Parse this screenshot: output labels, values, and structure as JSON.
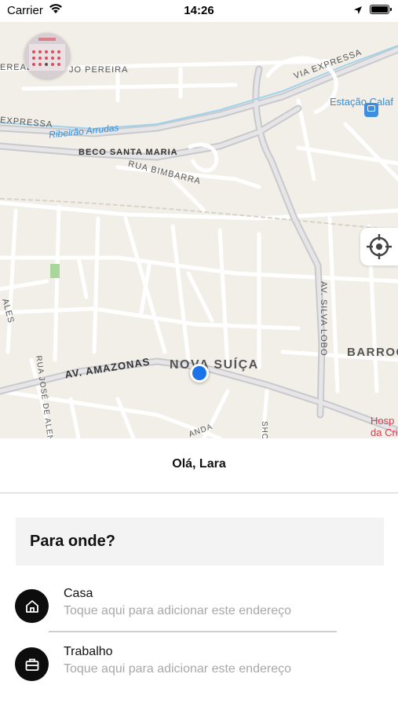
{
  "status_bar": {
    "carrier": "Carrier",
    "time": "14:26"
  },
  "map": {
    "labels": {
      "via_expressa": "VIA EXPRESSA",
      "expressa": "EXPRESSA",
      "ribeirao": "Ribeirão Arrudas",
      "beco": "BECO SANTA MARIA",
      "bimbarra": "RUA BIMBARRA",
      "amazonas": "AV. AMAZONAS",
      "nova_suica": "NOVA SUÍÇA",
      "silva_lobo": "AV. SILVA LOBO",
      "barroca": "BARROC",
      "estacao": "Estação Calaf",
      "hospital_1": "Hosp",
      "hospital_2": "da Cri",
      "jose_alencar": "RUA JOSÉ DE ALENCA",
      "ereal": "EREAL",
      "jo_pereira": "JO PEREIRA",
      "ales": "ALES",
      "anda": "ANDA",
      "shi": "SHO"
    }
  },
  "greeting": "Olá, Lara",
  "search": {
    "label": "Para onde?"
  },
  "places": [
    {
      "title": "Casa",
      "subtitle": "Toque aqui para adicionar este endereço",
      "icon": "home-icon"
    },
    {
      "title": "Trabalho",
      "subtitle": "Toque aqui para adicionar este endereço",
      "icon": "briefcase-icon"
    }
  ],
  "colors": {
    "map_background": "#f2efe9",
    "user_location": "#1a73e8",
    "icon_circle": "#0d0d0d",
    "search_background": "#f3f3f3"
  }
}
